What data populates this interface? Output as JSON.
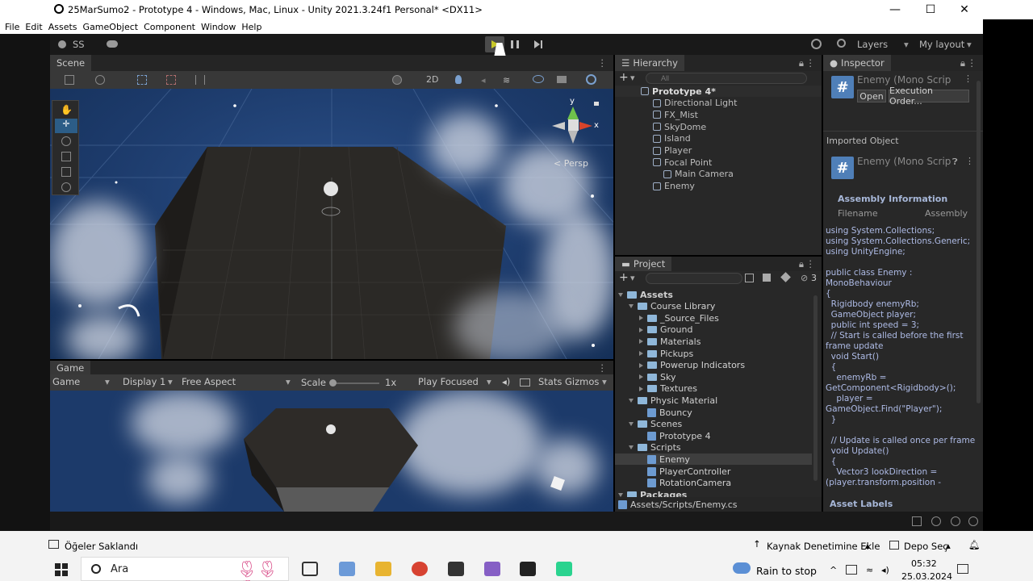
{
  "window": {
    "title": "25MarSumo2 - Prototype 4 - Windows, Mac, Linux - Unity 2021.3.24f1 Personal* <DX11>",
    "minimize": "—",
    "maximize": "☐",
    "close": "✕"
  },
  "menu": [
    "File",
    "Edit",
    "Assets",
    "GameObject",
    "Component",
    "Window",
    "Help"
  ],
  "toolbar": {
    "account": "SS",
    "layers": "Layers",
    "layout": "My layout"
  },
  "scene": {
    "tab": "Scene",
    "mode2d": "2D",
    "persp": "< Persp",
    "gizmo_y": "y",
    "gizmo_x": "x"
  },
  "game": {
    "tab": "Game",
    "mode": "Game",
    "display": "Display 1",
    "aspect": "Free Aspect",
    "scale_label": "Scale",
    "scale_value": "1x",
    "play_focused": "Play Focused",
    "stats": "Stats",
    "gizmos": "Gizmos"
  },
  "hierarchy": {
    "tab": "Hierarchy",
    "search_placeholder": "All",
    "items": [
      {
        "label": "Prototype 4*",
        "level": 0,
        "bold": true
      },
      {
        "label": "Directional Light",
        "level": 1
      },
      {
        "label": "FX_Mist",
        "level": 1
      },
      {
        "label": "SkyDome",
        "level": 1
      },
      {
        "label": "Island",
        "level": 1
      },
      {
        "label": "Player",
        "level": 1
      },
      {
        "label": "Focal Point",
        "level": 1
      },
      {
        "label": "Main Camera",
        "level": 2
      },
      {
        "label": "Enemy",
        "level": 1
      }
    ]
  },
  "project": {
    "tab": "Project",
    "count": "3",
    "path": "Assets/Scripts/Enemy.cs",
    "items": [
      {
        "label": "Assets",
        "level": 0,
        "type": "folder"
      },
      {
        "label": "Course Library",
        "level": 1,
        "type": "folder"
      },
      {
        "label": "_Source_Files",
        "level": 2,
        "type": "folder"
      },
      {
        "label": "Ground",
        "level": 2,
        "type": "folder"
      },
      {
        "label": "Materials",
        "level": 2,
        "type": "folder"
      },
      {
        "label": "Pickups",
        "level": 2,
        "type": "folder"
      },
      {
        "label": "Powerup Indicators",
        "level": 2,
        "type": "folder"
      },
      {
        "label": "Sky",
        "level": 2,
        "type": "folder"
      },
      {
        "label": "Textures",
        "level": 2,
        "type": "folder"
      },
      {
        "label": "Physic Material",
        "level": 1,
        "type": "folder"
      },
      {
        "label": "Bouncy",
        "level": 2,
        "type": "asset"
      },
      {
        "label": "Scenes",
        "level": 1,
        "type": "folder"
      },
      {
        "label": "Prototype 4",
        "level": 2,
        "type": "asset"
      },
      {
        "label": "Scripts",
        "level": 1,
        "type": "folder"
      },
      {
        "label": "Enemy",
        "level": 2,
        "type": "script",
        "selected": true
      },
      {
        "label": "PlayerController",
        "level": 2,
        "type": "script"
      },
      {
        "label": "RotationCamera",
        "level": 2,
        "type": "script"
      },
      {
        "label": "Packages",
        "level": 0,
        "type": "folder"
      }
    ]
  },
  "inspector": {
    "tab": "Inspector",
    "title": "Enemy (Mono Scrip",
    "open": "Open",
    "exec": "Execution Order...",
    "imported": "Imported Object",
    "title2": "Enemy (Mono Scrip",
    "assembly": "Assembly Information",
    "filename": "Filename",
    "assemblycol": "Assembly",
    "asset_labels": "Asset Labels",
    "code": [
      "using System.Collections;",
      "using System.Collections.Generic;",
      "using UnityEngine;",
      "",
      "public class Enemy :",
      "MonoBehaviour",
      "{",
      "  Rigidbody enemyRb;",
      "  GameObject player;",
      "  public int speed = 3;",
      "  // Start is called before the first",
      "frame update",
      "  void Start()",
      "  {",
      "    enemyRb =",
      "GetComponent<Rigidbody>();",
      "    player =",
      "GameObject.Find(\"Player\");",
      "  }",
      "",
      "  // Update is called once per frame",
      "  void Update()",
      "  {",
      "    Vector3 lookDirection =",
      "(player.transform.position -"
    ]
  },
  "notification": {
    "left": "Öğeler Saklandı",
    "vcs": "Kaynak Denetimine Ekle",
    "depot": "Depo Seç"
  },
  "taskbar": {
    "search": "Ara",
    "weather": "Rain to stop",
    "time": "05:32",
    "date": "25.03.2024"
  },
  "colors": {
    "accent": "#2c5d87",
    "play": "#c9c92a"
  }
}
